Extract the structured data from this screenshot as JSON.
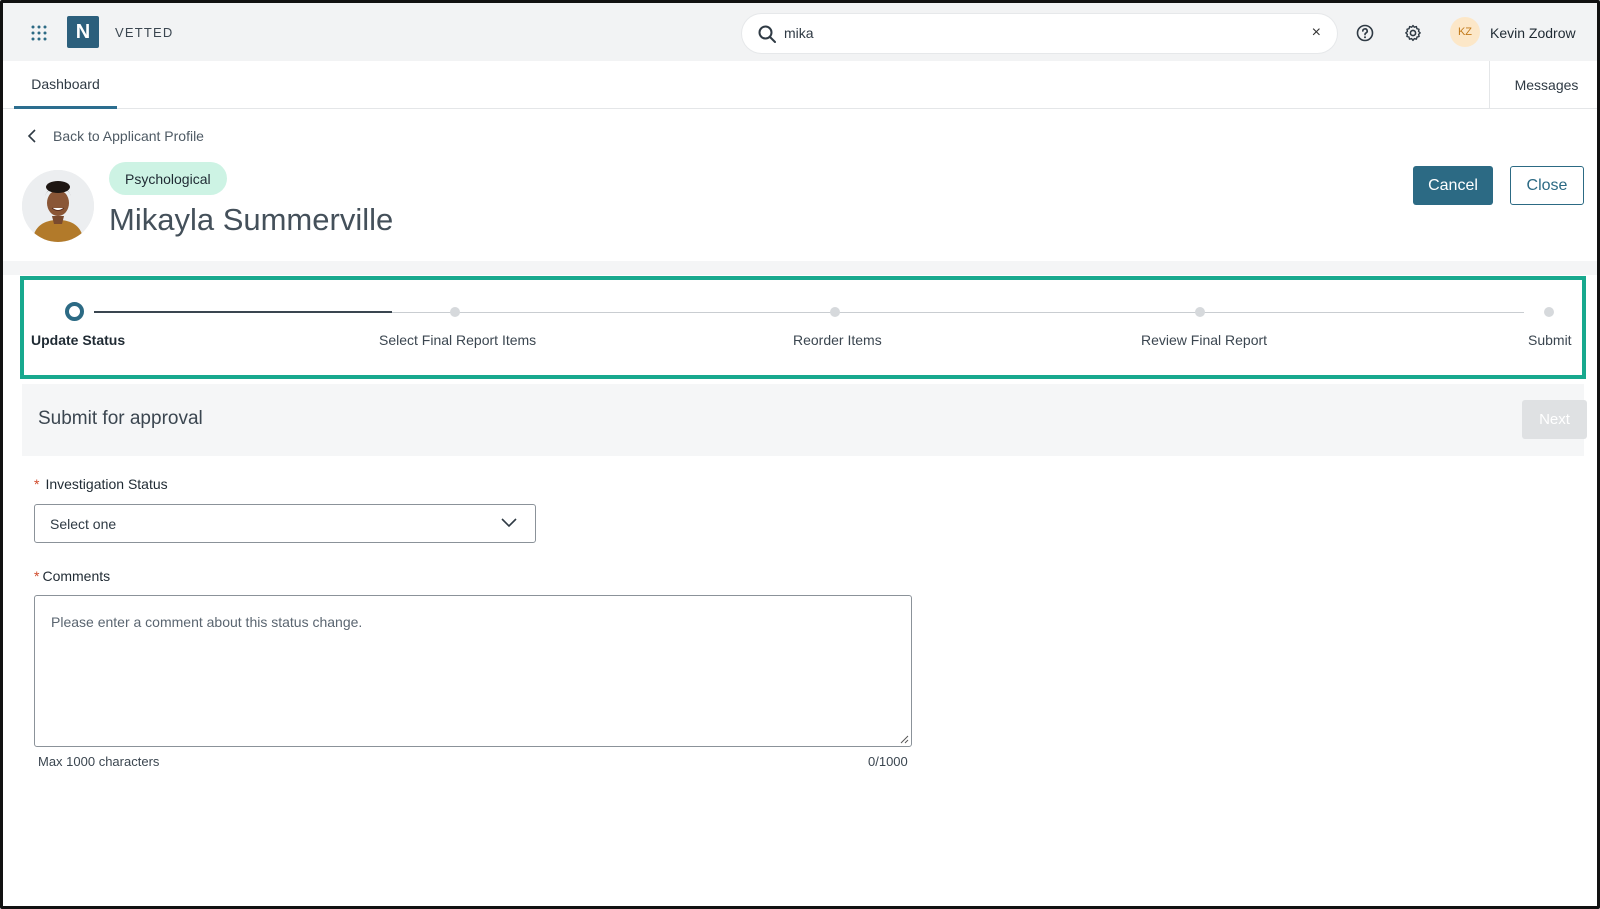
{
  "topbar": {
    "brand": "VETTED",
    "logo_letter": "N",
    "search_value": "mika",
    "clear_glyph": "×",
    "user_initials": "KZ",
    "user_name": "Kevin Zodrow"
  },
  "tabs": {
    "dashboard": "Dashboard",
    "messages": "Messages"
  },
  "header": {
    "back_label": "Back to Applicant Profile",
    "tag": "Psychological",
    "applicant_name": "Mikayla Summerville",
    "cancel_label": "Cancel",
    "close_label": "Close"
  },
  "stepper": {
    "steps": [
      {
        "label": "Update Status",
        "state": "active"
      },
      {
        "label": "Select Final Report Items",
        "state": "upcoming"
      },
      {
        "label": "Reorder Items",
        "state": "upcoming"
      },
      {
        "label": "Review Final Report",
        "state": "upcoming"
      },
      {
        "label": "Submit",
        "state": "upcoming"
      }
    ],
    "accent_color": "#18a98e"
  },
  "section": {
    "title": "Submit for approval",
    "next_label": "Next"
  },
  "form": {
    "required_mark": "*",
    "status_label": "Investigation Status",
    "status_value": "Select one",
    "comments_label": "Comments",
    "comments_placeholder": "Please enter a comment about this status change.",
    "max_hint": "Max 1000 characters",
    "counter": "0/1000"
  },
  "colors": {
    "primary": "#2c6a84",
    "tag_bg": "#cdf3e4",
    "required": "#d04a2a"
  },
  "icons": [
    "apps-grid-icon",
    "search-icon",
    "close-icon",
    "help-icon",
    "gear-icon",
    "chevron-left-icon",
    "chevron-down-icon"
  ]
}
